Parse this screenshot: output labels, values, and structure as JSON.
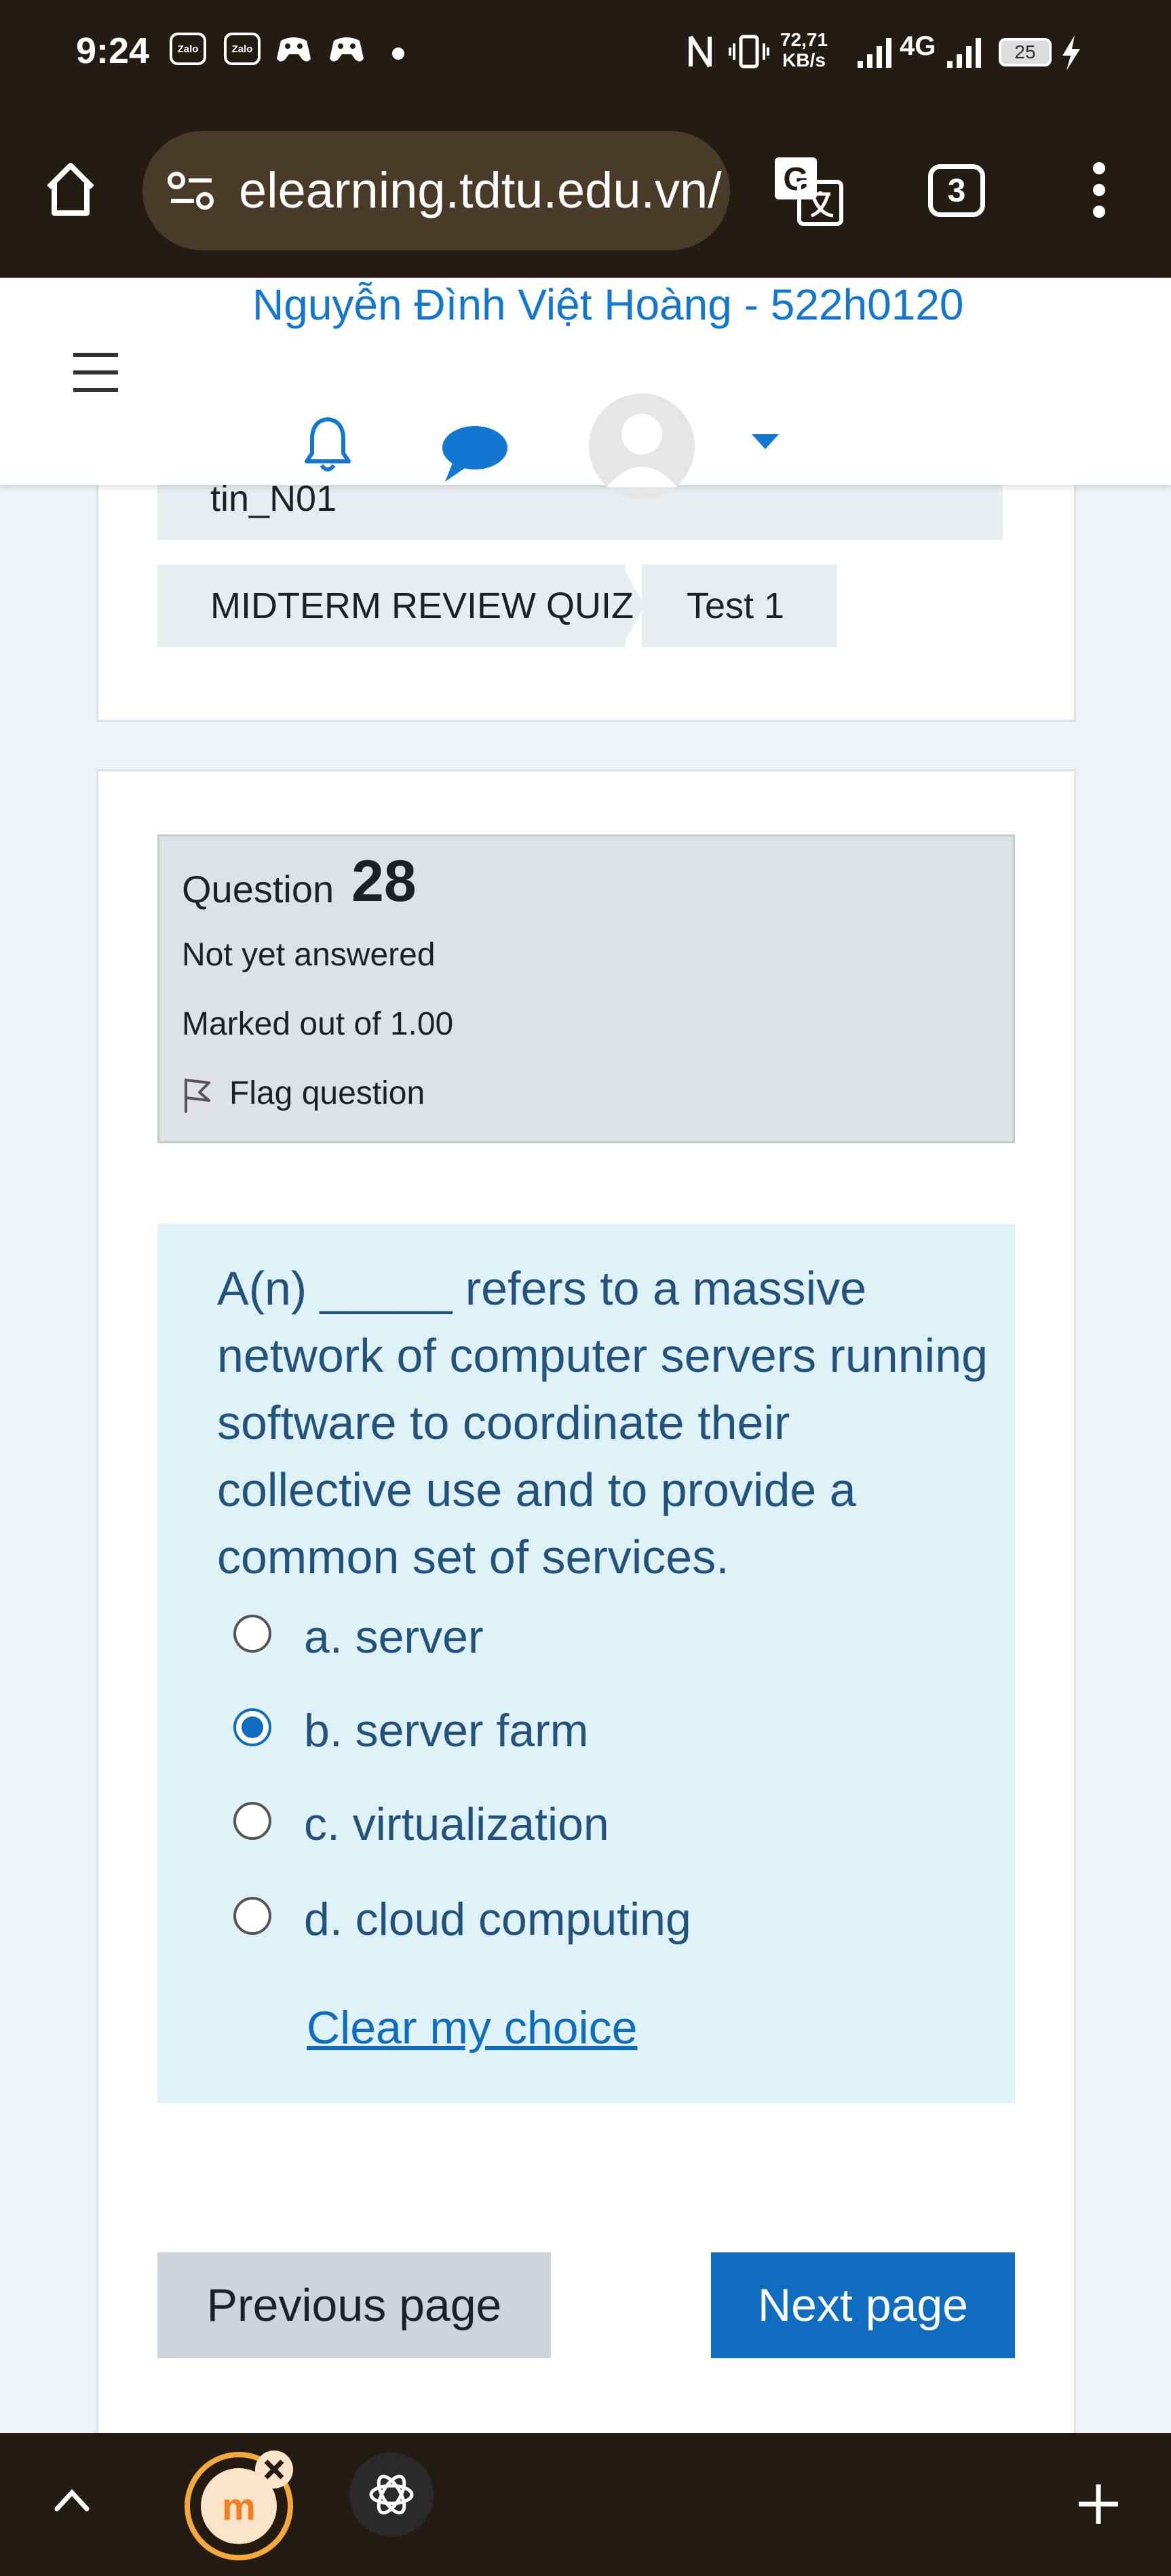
{
  "status_bar": {
    "time": "9:24",
    "zalo_label": "Zalo",
    "net_speed_value": "72,71",
    "net_speed_unit": "KB/s",
    "network": "4G",
    "battery": "25"
  },
  "browser": {
    "url": "elearning.tdtu.edu.vn/",
    "tab_count": "3"
  },
  "header": {
    "user_name": "Nguyễn Đình Việt Hoàng - 522h0120"
  },
  "breadcrumb": {
    "course_tail": "tin_N01",
    "items": [
      "MIDTERM REVIEW QUIZ",
      "Test 1"
    ]
  },
  "question": {
    "label": "Question",
    "number": "28",
    "status": "Not yet answered",
    "marks": "Marked out of 1.00",
    "flag_label": "Flag question",
    "text": "A(n) _____ refers to a massive network of computer servers running software to coordinate their collective use and to provide a common set of services.",
    "options": [
      {
        "label": "a. server",
        "checked": false
      },
      {
        "label": "b. server farm",
        "checked": true
      },
      {
        "label": "c. virtualization",
        "checked": false
      },
      {
        "label": "d. cloud computing",
        "checked": false
      }
    ],
    "clear_label": "Clear my choice"
  },
  "navigation": {
    "previous_label": "Previous page",
    "next_label": "Next page"
  },
  "colors": {
    "accent": "#0f6cbf",
    "username": "#1177d1",
    "question_bg": "#def2f8",
    "info_bg": "#dee2e6",
    "chrome": "#241b12"
  }
}
